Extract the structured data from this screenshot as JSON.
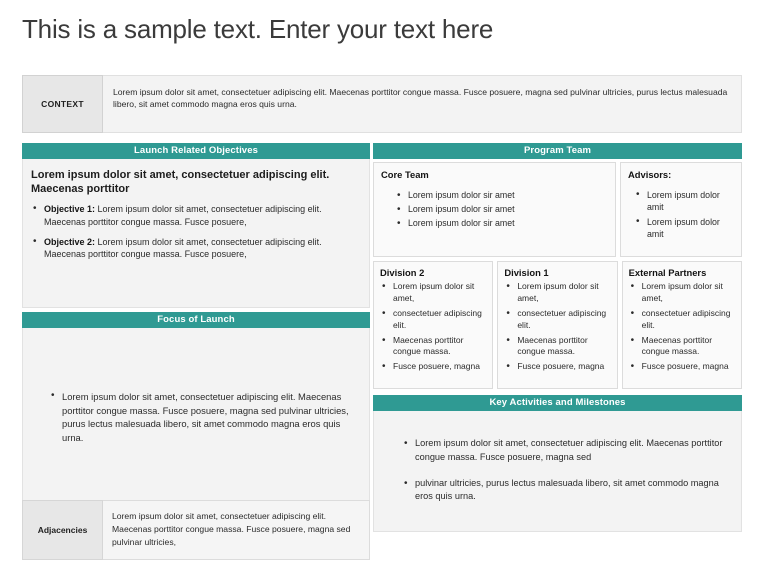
{
  "slide": {
    "title": "This is a sample text. Enter your text here",
    "accent_color": "#2f9a93",
    "label_bg_color": "#e7e7e7",
    "panel_bg_color": "#f3f3f3"
  },
  "context": {
    "label": "CONTEXT",
    "body": "Lorem ipsum dolor sit amet, consectetuer adipiscing elit. Maecenas porttitor congue massa. Fusce posuere, magna sed pulvinar ultricies, purus lectus malesuada libero, sit amet commodo magna eros quis urna."
  },
  "objectives": {
    "header": "Launch Related Objectives",
    "heading": "Lorem ipsum dolor sit amet, consectetuer adipiscing elit. Maecenas porttitor",
    "items": [
      {
        "label": "Objective 1:",
        "text": " Lorem ipsum dolor sit amet, consectetuer adipiscing elit. Maecenas porttitor congue massa. Fusce posuere,"
      },
      {
        "label": "Objective 2:",
        "text": " Lorem ipsum dolor sit amet, consectetuer adipiscing elit. Maecenas porttitor congue massa. Fusce posuere,"
      }
    ]
  },
  "focus": {
    "header": "Focus of Launch",
    "items": [
      "Lorem ipsum dolor sit amet, consectetuer adipiscing elit. Maecenas porttitor congue massa. Fusce posuere, magna sed pulvinar ultricies, purus lectus malesuada libero, sit amet commodo magna eros quis urna."
    ]
  },
  "adjacencies": {
    "label": "Adjacencies",
    "body": "Lorem ipsum dolor sit amet, consectetuer adipiscing elit. Maecenas porttitor congue massa. Fusce posuere, magna sed pulvinar ultricies,"
  },
  "program_team": {
    "header": "Program Team",
    "core_team": {
      "heading": "Core Team",
      "items": [
        "Lorem ipsum dolor sir amet",
        "Lorem ipsum dolor sir amet",
        "Lorem ipsum dolor sir amet"
      ]
    },
    "advisors": {
      "heading": "Advisors:",
      "items": [
        "Lorem ipsum dolor amit",
        "Lorem ipsum dolor amit"
      ]
    },
    "divisions": [
      {
        "heading": "Division 2",
        "items": [
          "Lorem ipsum dolor sit amet,",
          "consectetuer adipiscing elit.",
          "Maecenas porttitor congue massa.",
          "Fusce posuere, magna"
        ]
      },
      {
        "heading": "Division 1",
        "items": [
          "Lorem ipsum dolor sit amet,",
          "consectetuer adipiscing elit.",
          "Maecenas porttitor congue massa.",
          "Fusce posuere, magna"
        ]
      },
      {
        "heading": "External Partners",
        "items": [
          "Lorem ipsum dolor sit amet,",
          "consectetuer adipiscing elit.",
          "Maecenas porttitor congue massa.",
          "Fusce posuere, magna"
        ]
      }
    ]
  },
  "milestones": {
    "header": "Key Activities and Milestones",
    "items": [
      "Lorem ipsum dolor sit amet, consectetuer adipiscing elit. Maecenas porttitor congue massa. Fusce posuere, magna sed",
      "pulvinar ultricies, purus lectus malesuada libero, sit amet commodo magna eros quis urna."
    ]
  }
}
